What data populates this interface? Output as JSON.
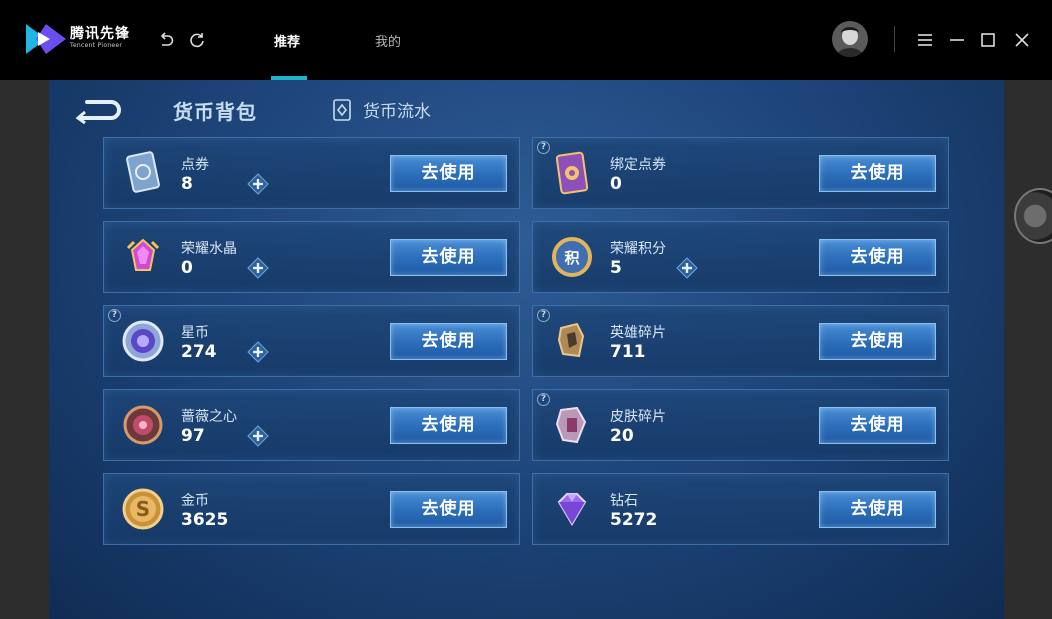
{
  "app": {
    "brand_name": "腾讯先锋",
    "brand_sub": "Tencent Pioneer",
    "tabs": [
      {
        "label": "推荐",
        "active": true
      },
      {
        "label": "我的",
        "active": false
      }
    ],
    "accent_color": "#1fb5c6"
  },
  "page": {
    "title": "货币背包",
    "flow_link": "货币流水"
  },
  "currencies": [
    {
      "name": "点券",
      "value": "8",
      "button": "去使用",
      "has_plus": true,
      "has_help": false,
      "icon": "voucher-card-icon"
    },
    {
      "name": "绑定点券",
      "value": "0",
      "button": "去使用",
      "has_plus": false,
      "has_help": true,
      "icon": "bound-voucher-card-icon"
    },
    {
      "name": "荣耀水晶",
      "value": "0",
      "button": "去使用",
      "has_plus": true,
      "has_help": false,
      "icon": "glory-crystal-icon"
    },
    {
      "name": "荣耀积分",
      "value": "5",
      "button": "去使用",
      "has_plus": true,
      "has_help": false,
      "icon": "glory-points-icon"
    },
    {
      "name": "星币",
      "value": "274",
      "button": "去使用",
      "has_plus": true,
      "has_help": true,
      "icon": "star-coin-icon"
    },
    {
      "name": "英雄碎片",
      "value": "711",
      "button": "去使用",
      "has_plus": false,
      "has_help": true,
      "icon": "hero-fragment-icon"
    },
    {
      "name": "蔷薇之心",
      "value": "97",
      "button": "去使用",
      "has_plus": true,
      "has_help": false,
      "icon": "rose-heart-icon"
    },
    {
      "name": "皮肤碎片",
      "value": "20",
      "button": "去使用",
      "has_plus": false,
      "has_help": true,
      "icon": "skin-fragment-icon"
    },
    {
      "name": "金币",
      "value": "3625",
      "button": "去使用",
      "has_plus": false,
      "has_help": false,
      "icon": "gold-coin-icon"
    },
    {
      "name": "钻石",
      "value": "5272",
      "button": "去使用",
      "has_plus": false,
      "has_help": false,
      "icon": "diamond-icon"
    }
  ]
}
